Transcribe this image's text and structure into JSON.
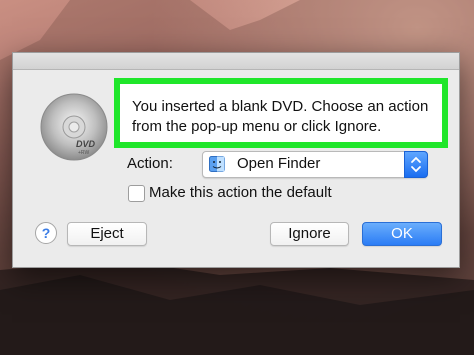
{
  "dialog": {
    "message": "You inserted a blank DVD. Choose an action from the pop-up menu or click Ignore.",
    "action_label": "Action:",
    "action_value": "Open Finder",
    "checkbox_label": "Make this action the default",
    "checkbox_checked": false,
    "help_label": "?",
    "eject_label": "Eject",
    "ignore_label": "Ignore",
    "ok_label": "OK"
  },
  "dvd_icon": {
    "text": "DVD",
    "subtext": "+RW"
  },
  "colors": {
    "highlight": "#1fe62a",
    "ok_button": "#2b7cf5",
    "popup_stepper": "#1a6df0"
  }
}
